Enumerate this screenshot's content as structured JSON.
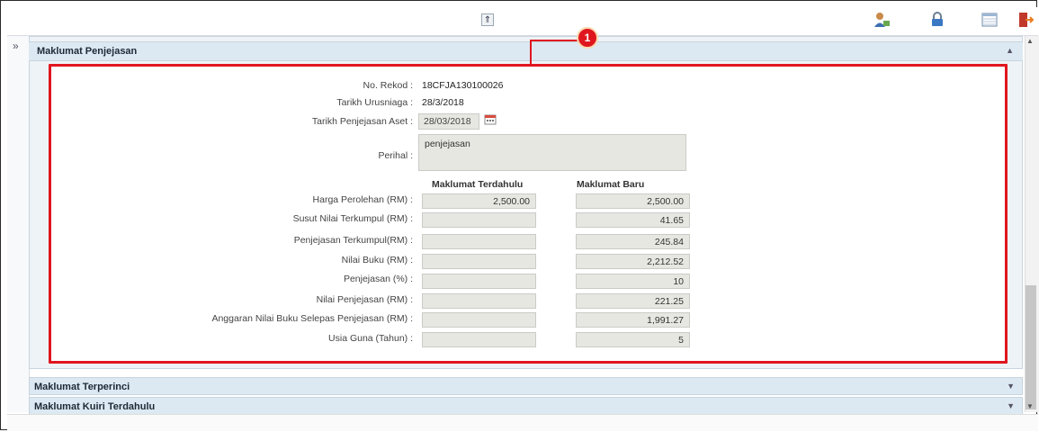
{
  "toolbar": {
    "collapse_icon": "double-chevron-up-icon",
    "icons": [
      "user-icon",
      "lock-icon",
      "table-view-icon",
      "exit-icon"
    ]
  },
  "sidebar": {
    "expand_icon": "double-chevron-right-icon",
    "expand_glyph": "»"
  },
  "callout": {
    "number": "1",
    "color": "#e0161f"
  },
  "panel": {
    "title": "Maklumat Penjejasan",
    "fields": {
      "no_rekod_label": "No. Rekod :",
      "no_rekod_value": "18CFJA130100026",
      "tarikh_urusniaga_label": "Tarikh Urusniaga :",
      "tarikh_urusniaga_value": "28/3/2018",
      "tarikh_penjejasan_label": "Tarikh Penjejasan Aset :",
      "tarikh_penjejasan_value": "28/03/2018",
      "perihal_label": "Perihal :",
      "perihal_value": "penjejasan"
    },
    "columns": {
      "previous": "Maklumat Terdahulu",
      "new": "Maklumat Baru"
    },
    "rows": [
      {
        "label": "Harga Perolehan (RM) :",
        "previous": "2,500.00",
        "new": "2,500.00"
      },
      {
        "label": "Susut Nilai Terkumpul (RM) :",
        "previous": "",
        "new": "41.65"
      },
      {
        "label": "Penjejasan Terkumpul(RM) :",
        "previous": "",
        "new": "245.84"
      },
      {
        "label": "Nilai Buku (RM) :",
        "previous": "",
        "new": "2,212.52"
      },
      {
        "label": "Penjejasan (%) :",
        "previous": "",
        "new": "10"
      },
      {
        "label": "Nilai Penjejasan (RM) :",
        "previous": "",
        "new": "221.25"
      },
      {
        "label": "Anggaran Nilai Buku Selepas Penjejasan (RM) :",
        "previous": "",
        "new": "1,991.27"
      },
      {
        "label": "Usia Guna (Tahun) :",
        "previous": "",
        "new": "5"
      }
    ]
  },
  "sections": [
    {
      "title": "Maklumat Terperinci"
    },
    {
      "title": "Maklumat Kuiri Terdahulu"
    }
  ]
}
